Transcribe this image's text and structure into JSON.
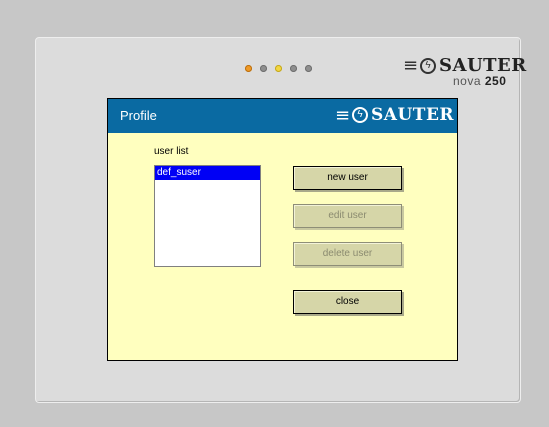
{
  "device": {
    "brand": "SAUTER",
    "model_prefix": "nova",
    "model_number": "250",
    "leds": [
      "orange",
      "gray",
      "yellow",
      "gray",
      "gray"
    ]
  },
  "window": {
    "title": "Profile",
    "brand": "SAUTER"
  },
  "userlist": {
    "label": "user list",
    "items": [
      "def_suser"
    ],
    "selected_index": 0
  },
  "buttons": {
    "new_user": "new user",
    "edit_user": "edit user",
    "delete_user": "delete user",
    "close": "close"
  },
  "colors": {
    "titlebar": "#0a6aa2",
    "screen_background": "#ffffbf",
    "button_face": "#d6d6a8",
    "selection": "#0000f5"
  }
}
